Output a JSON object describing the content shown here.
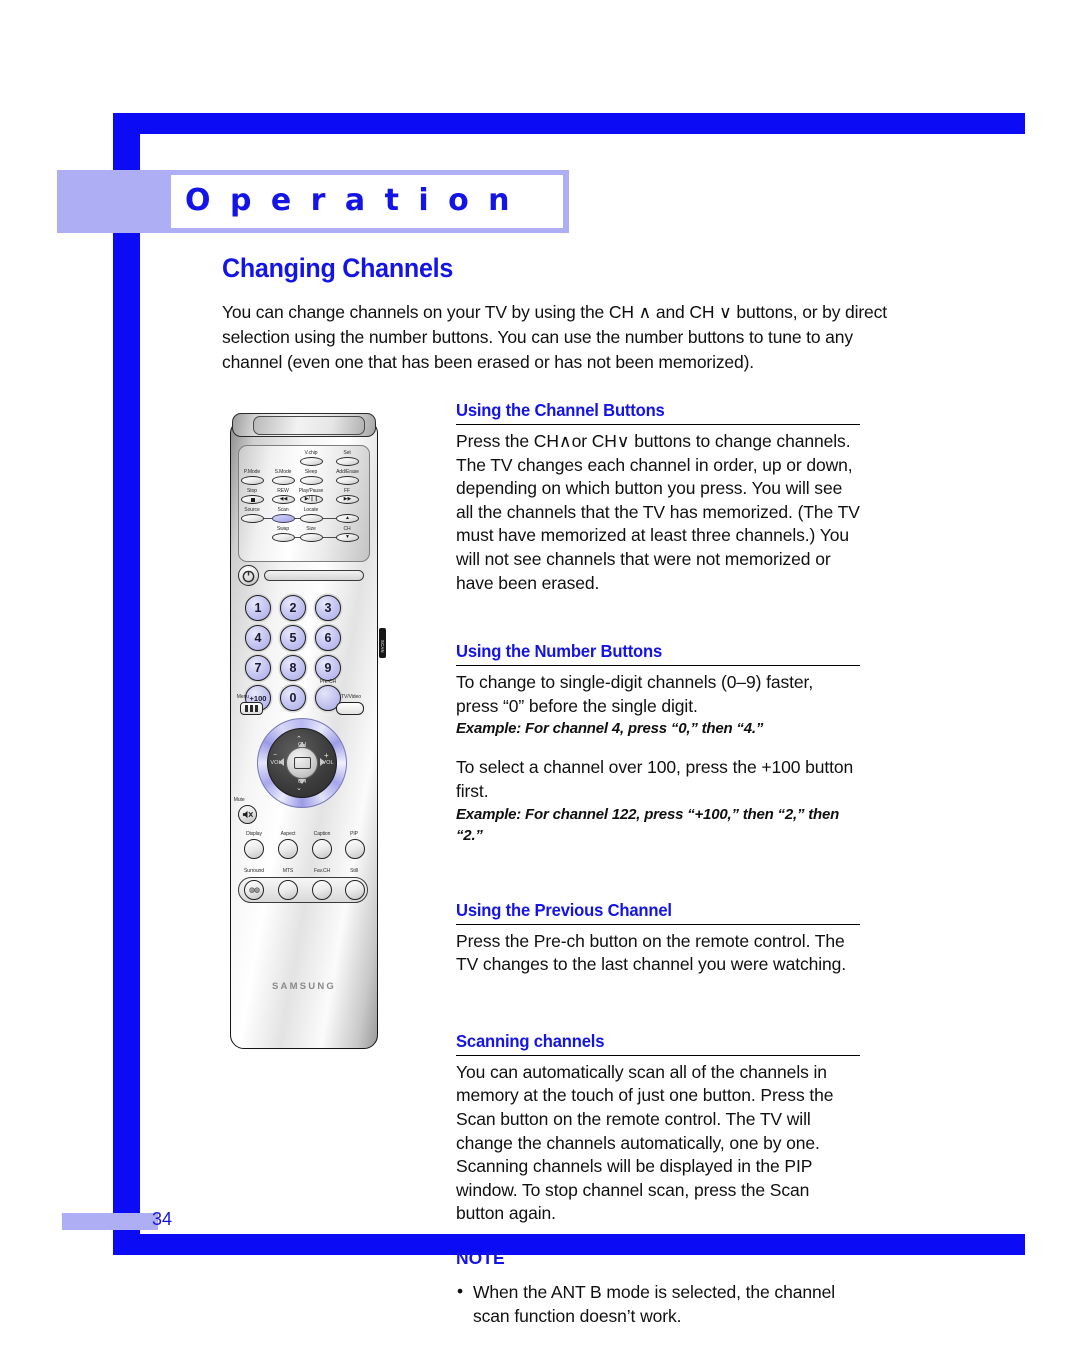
{
  "chapter": {
    "title": "O p e r a t i o n"
  },
  "page": {
    "heading": "Changing Channels",
    "number": "34",
    "intro": "You can change channels on your TV by using the CH ∧ and CH ∨ buttons, or by direct selection using the number buttons. You can use the number buttons to tune to any channel (even one that has been erased or has not been memorized)."
  },
  "sections": [
    {
      "heading": "Using the Channel Buttons",
      "body": "Press the CH∧or CH∨  buttons to change channels. The TV changes each channel in order, up or down, depending on which button you press. You will see all the channels that the TV has memorized. (The TV must have memorized at least three channels.) You will not see channels that were not memorized or have been erased."
    },
    {
      "heading": "Using the Number Buttons",
      "body1": "To change to single-digit channels (0–9) faster, press “0” before the single digit.",
      "example1": "Example: For channel 4, press “0,” then “4.”",
      "body2": "To select a channel over 100, press the +100 button first.",
      "example2": "Example: For channel 122, press “+100,” then “2,” then “2.”"
    },
    {
      "heading": "Using the Previous Channel",
      "body": "Press the Pre-ch button on the remote control.  The TV changes to the last channel you were watching."
    },
    {
      "heading": "Scanning channels",
      "body": "You can automatically scan all of the channels in memory at the touch of just one button. Press the Scan button on the remote control. The TV will change the channels automatically, one by one. Scanning channels will be displayed in the PIP window. To stop channel scan, press the Scan button again."
    }
  ],
  "note": {
    "heading": "NOTE",
    "bullet": "•",
    "items": [
      "When the ANT B mode is selected, the channel scan function doesn’t work."
    ]
  },
  "remote": {
    "brand": "SAMSUNG",
    "side_label": "SCAN",
    "function_buttons": {
      "vchip": "V.chip",
      "set": "Set",
      "pmode": "P.Mode",
      "smode": "S.Mode",
      "sleep": "Sleep",
      "adderase": "Add/Erase",
      "stop": "Stop",
      "rew": "REW",
      "playpause": "Play/Pause",
      "ff": "FF",
      "source": "Source",
      "scan": "Scan",
      "locate": "Locate",
      "swap": "Swap",
      "size": "Size",
      "ch": "CH"
    },
    "numbers": [
      "1",
      "2",
      "3",
      "4",
      "5",
      "6",
      "7",
      "8",
      "9",
      "+100",
      "0"
    ],
    "prech": "Pre-CH",
    "menu": "Menu",
    "tvvideo": "TV/Video",
    "dpad": {
      "ch_up": "CH",
      "ch_down": "CH",
      "vol_minus": "VOL",
      "vol_plus": "VOL",
      "minus": "−",
      "plus": "+"
    },
    "mute": "Mute",
    "row1": [
      "Display",
      "Aspect",
      "Caption",
      "PIP"
    ],
    "row2": [
      "Surround",
      "MTS",
      "Fav.CH",
      "Still"
    ]
  },
  "colors": {
    "rule_blue": "#0B0BF5",
    "heading_blue": "#1414E6",
    "band_lavender": "#AEAEF5",
    "highlight_button": "#b9b9ef"
  }
}
